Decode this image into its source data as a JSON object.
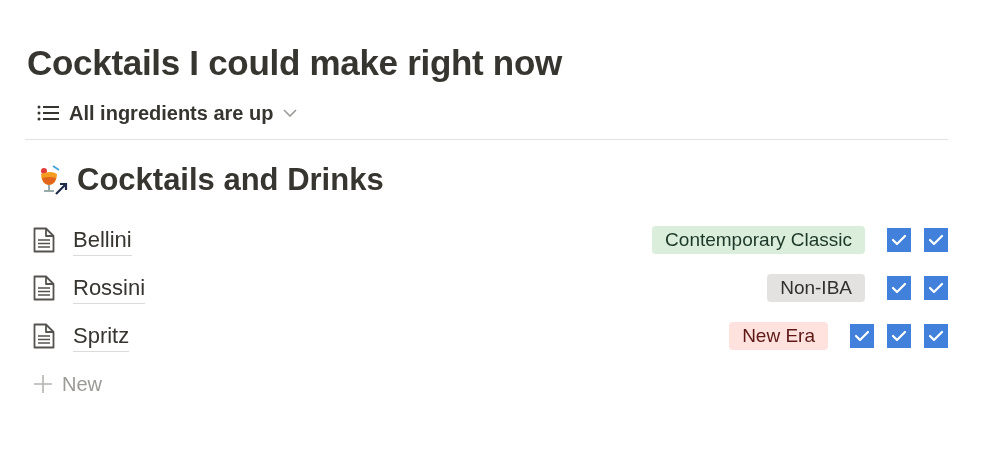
{
  "page_title": "Cocktails I could make right now",
  "view_tab": {
    "label": "All ingredients are up"
  },
  "section_title": "Cocktails and Drinks",
  "rows": [
    {
      "name": "Bellini",
      "tag": {
        "label": "Contemporary Classic",
        "color": "#dbeddb"
      },
      "checks": [
        {
          "checked": true
        },
        {
          "checked": true
        }
      ]
    },
    {
      "name": "Rossini",
      "tag": {
        "label": "Non-IBA",
        "color": "#e3e2e0"
      },
      "checks": [
        {
          "checked": true
        },
        {
          "checked": true
        }
      ]
    },
    {
      "name": "Spritz",
      "tag": {
        "label": "New Era",
        "color": "#ffe2dd"
      },
      "checks": [
        {
          "checked": true
        },
        {
          "checked": true
        },
        {
          "checked": true
        }
      ]
    }
  ],
  "new_button": {
    "label": "New"
  }
}
